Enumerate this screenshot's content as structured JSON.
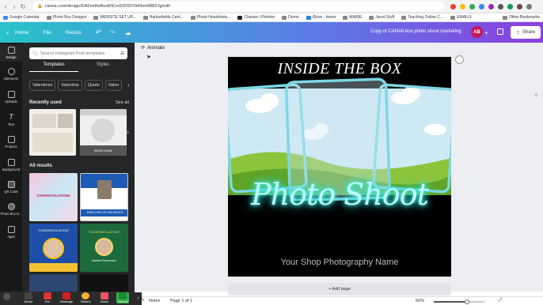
{
  "browser": {
    "url": "canva.com/design/DAFeeRsBez8/lCvn0J0SVVkKkeH8l83-fg/edit",
    "bookmarks": [
      "Google Calendar",
      "Photo Box Designs",
      "WEBSITE SET UP...",
      "Harborfields Cent...",
      "Photo Headshots...",
      "Classes | Peloton",
      "Demo",
      "iDrive - home",
      "MAINE",
      "Jared Stuff",
      "Teaching Online C...",
      "EMAILS"
    ],
    "other_bookmarks": "Other Bookmarks"
  },
  "header": {
    "home": "Home",
    "file": "File",
    "resize": "Resize",
    "doc_title": "Copy of CANVA box photo shoot marketing",
    "avatar": "AB",
    "share": "Share"
  },
  "rail": [
    "Design",
    "Elements",
    "Uploads",
    "Text",
    "Projects",
    "Background",
    "QR Code",
    "Photo Box D...",
    "Apps"
  ],
  "panel": {
    "search_placeholder": "Search Instagram Post templates",
    "tab_templates": "Templates",
    "tab_styles": "Styles",
    "chips": [
      "Valentines",
      "Valentine",
      "Quote",
      "Valen"
    ],
    "recent_heading": "Recently used",
    "see_all": "See all",
    "all_results": "All results",
    "t1a": "CONGRATULATIONS",
    "t1b": "EMPLOYEE OF THE MONTH",
    "t2a": "\"CONGRATULATION\"",
    "t2b": "\"CONGRATULATION\"",
    "t2c": "Adeline Palmerston",
    "thumb_boxphoto": "BOOK NOW"
  },
  "canvas": {
    "animate": "Animate",
    "title": "INSIDE THE BOX",
    "neon": "Photo Shoot",
    "footer": "Your Shop Photography Name",
    "add_page": "+ Add page"
  },
  "bottom": {
    "notes": "Notes",
    "page": "Page 1 of 1",
    "zoom": "66%",
    "zoom_fraction": 0.66
  },
  "dock": [
    "Mouse",
    "Pen",
    "Rectangle",
    "Stickers",
    "Eraser",
    "Clear All"
  ],
  "colors": {
    "accent_teal": "#27c3c9",
    "accent_purple": "#8a3fe0",
    "neon": "#3ff2e6",
    "avatar": "#c2185b"
  }
}
